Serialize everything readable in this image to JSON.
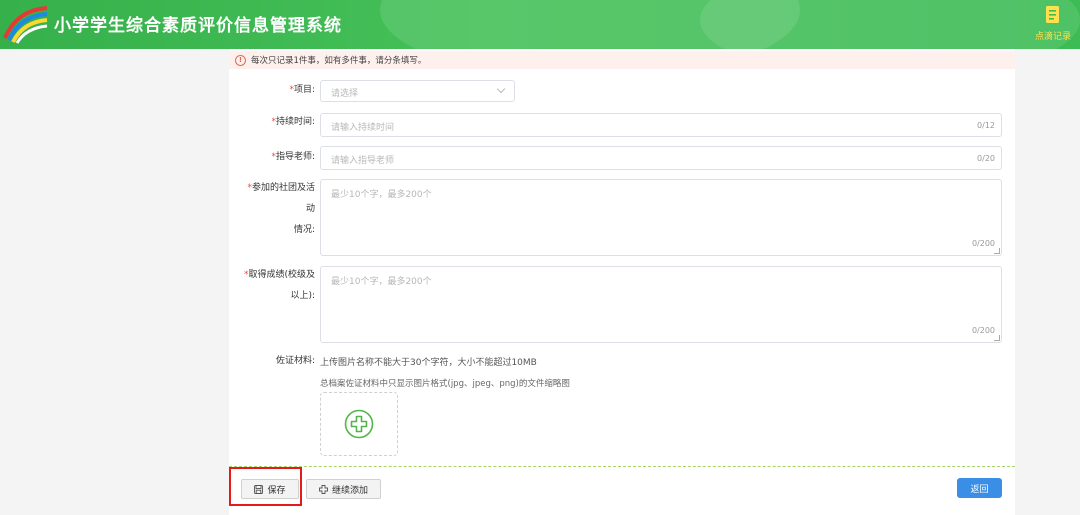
{
  "header": {
    "app_title": "小学学生综合素质评价信息管理系统",
    "record_label": "点滴记录",
    "logo_icon": "rainbow-logo-icon",
    "record_icon": "notebook-icon"
  },
  "alert": {
    "text": "每次只记录1件事，如有多件事，请分条填写。",
    "icon": "info-icon"
  },
  "form": {
    "project": {
      "label": "项目:",
      "placeholder": "请选择"
    },
    "duration": {
      "label": "持续时间:",
      "placeholder": "请输入持续时间",
      "count": "0/12"
    },
    "teacher": {
      "label": "指导老师:",
      "placeholder": "请输入指导老师",
      "count": "0/20"
    },
    "activities": {
      "label_line1": "参加的社团及活动",
      "label_line2": "情况:",
      "placeholder": "最少10个字，最多200个",
      "count": "0/200"
    },
    "achievement": {
      "label_line1": "取得成绩(校级及",
      "label_line2": "以上):",
      "placeholder": "最少10个字，最多200个",
      "count": "0/200"
    },
    "evidence": {
      "label": "佐证材料:",
      "hint1": "上传图片名称不能大于30个字符，大小不能超过10MB",
      "hint2": "总档案佐证材料中只显示图片格式(jpg、jpeg、png)的文件缩略图"
    },
    "required_mark": "*"
  },
  "actions": {
    "save_label": "保存",
    "continue_label": "继续添加",
    "back_label": "返回"
  },
  "colors": {
    "header_green": "#3dbb55",
    "required_red": "#e74c3c",
    "primary_blue": "#3a8ee6",
    "upload_green": "#52b54a",
    "highlight_red": "#e31b1b"
  }
}
